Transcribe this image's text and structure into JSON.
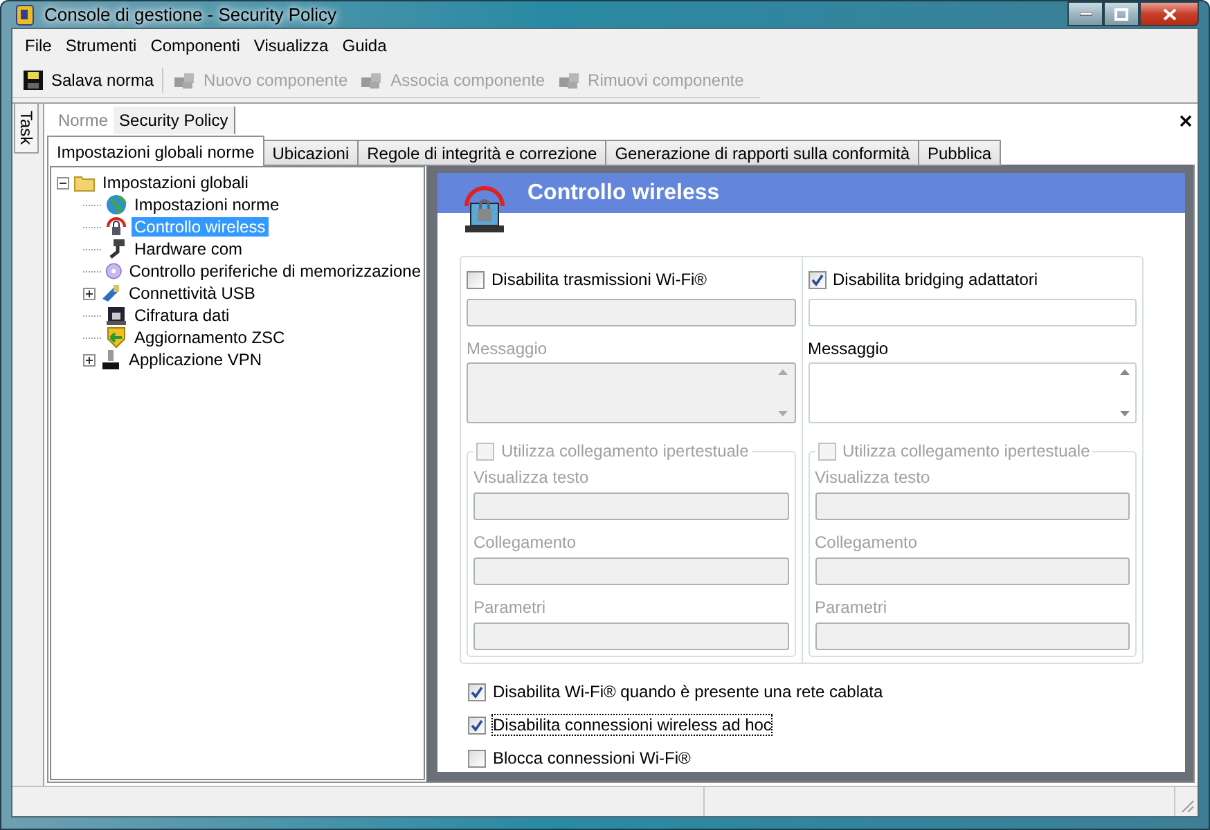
{
  "window": {
    "title": "Console di gestione  - Security Policy"
  },
  "menu": [
    "File",
    "Strumenti",
    "Componenti",
    "Visualizza",
    "Guida"
  ],
  "toolbar": [
    {
      "label": "Salava norma",
      "disabled": false
    },
    {
      "label": "Nuovo componente",
      "disabled": true
    },
    {
      "label": "Associa componente",
      "disabled": true
    },
    {
      "label": "Rimuovi componente",
      "disabled": true
    }
  ],
  "side_tab": "Task",
  "document_tabs": [
    {
      "label": "Norme",
      "selected": false
    },
    {
      "label": "Security Policy",
      "selected": true
    }
  ],
  "section_tabs": [
    {
      "label": "Impostazioni globali norme",
      "selected": true
    },
    {
      "label": "Ubicazioni",
      "selected": false
    },
    {
      "label": "Regole di integrità e correzione",
      "selected": false
    },
    {
      "label": "Generazione di rapporti sulla conformità",
      "selected": false
    },
    {
      "label": "Pubblica",
      "selected": false
    }
  ],
  "tree": [
    {
      "label": "Impostazioni globali",
      "selected": false,
      "expanded": true,
      "children": [
        {
          "label": "Impostazioni norme",
          "selected": false
        },
        {
          "label": "Controllo wireless",
          "selected": true
        },
        {
          "label": "Hardware com",
          "selected": false
        },
        {
          "label": "Controllo periferiche di memorizzazione",
          "selected": false
        },
        {
          "label": "Connettività USB",
          "selected": false,
          "expanded": false
        },
        {
          "label": "Cifratura dati",
          "selected": false
        },
        {
          "label": "Aggiornamento ZSC",
          "selected": false
        },
        {
          "label": "Applicazione VPN",
          "selected": false,
          "expanded": false
        }
      ]
    }
  ],
  "panel": {
    "title": "Controllo wireless",
    "groups": [
      {
        "option": {
          "label": "Disabilita trasmissioni Wi-Fi®",
          "checked": false
        },
        "disabled": true,
        "message_label": "Messaggio",
        "link": {
          "label": "Utilizza collegamento ipertestuale",
          "checked": false,
          "disabled": true,
          "fields": [
            "Visualizza testo",
            "Collegamento",
            "Parametri"
          ]
        }
      },
      {
        "option": {
          "label": "Disabilita bridging adattatori",
          "checked": true
        },
        "disabled": false,
        "message_label": "Messaggio",
        "link": {
          "label": "Utilizza collegamento ipertestuale",
          "checked": false,
          "disabled": true,
          "fields": [
            "Visualizza testo",
            "Collegamento",
            "Parametri"
          ]
        }
      }
    ],
    "options": [
      {
        "label": "Disabilita Wi-Fi® quando è presente una rete cablata",
        "checked": true,
        "focused": false
      },
      {
        "label": "Disabilita connessioni wireless ad hoc",
        "checked": true,
        "focused": true
      },
      {
        "label": "Blocca connessioni Wi-Fi®",
        "checked": false,
        "focused": false
      }
    ]
  }
}
